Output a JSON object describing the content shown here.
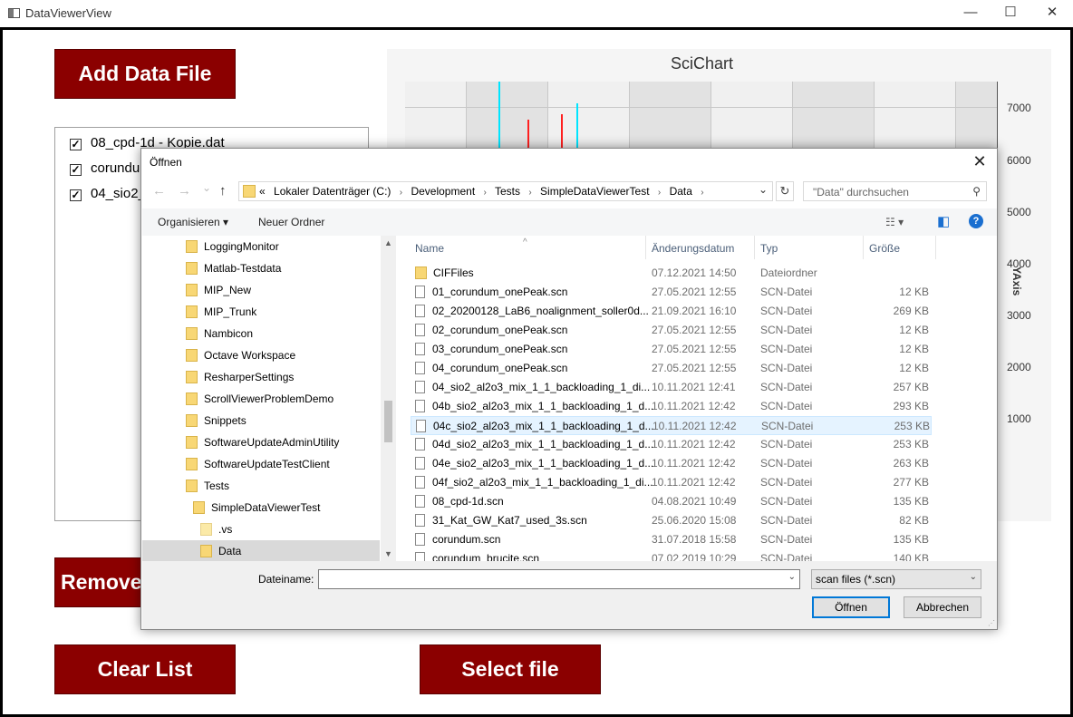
{
  "window": {
    "title": "DataViewerView",
    "minimize_glyph": "—",
    "maximize_glyph": "☐",
    "close_glyph": "✕"
  },
  "buttons": {
    "add": "Add Data File",
    "remove": "Remove",
    "clear": "Clear List",
    "select": "Select file"
  },
  "file_list": [
    {
      "label": "08_cpd-1d - Kopie.dat",
      "checked": true
    },
    {
      "label": "corundu",
      "checked": true
    },
    {
      "label": "04_sio2_",
      "checked": true
    }
  ],
  "chart": {
    "title": "SciChart",
    "y_axis_title": "YAxis",
    "y_ticks": [
      "7000",
      "6000",
      "5000",
      "4000",
      "3000",
      "2000",
      "1000"
    ]
  },
  "chart_data": {
    "type": "line",
    "title": "SciChart",
    "ylabel": "YAxis",
    "y_ticks": [
      7000,
      6000,
      5000,
      4000,
      3000,
      2000,
      1000
    ],
    "ylim": [
      0,
      7500
    ],
    "grid": true,
    "series": [
      {
        "color": "#00e5ff"
      },
      {
        "color": "#ff2020"
      }
    ]
  },
  "dialog": {
    "title": "Öffnen",
    "close_glyph": "✕",
    "nav_back": "←",
    "nav_forward": "→",
    "nav_recent": "⌄",
    "nav_up": "↑",
    "breadcrumb": [
      "«",
      "Lokaler Datenträger (C:)",
      "Development",
      "Tests",
      "SimpleDataViewerTest",
      "Data"
    ],
    "breadcrumb_sep": "›",
    "address_dropdown": "⌄",
    "refresh_glyph": "↻",
    "search_placeholder": "\"Data\" durchsuchen",
    "search_glyph": "⚲",
    "toolbar": {
      "organize": "Organisieren ▾",
      "new_folder": "Neuer Ordner",
      "view_glyph": "☷ ▾",
      "pane_glyph": "◧",
      "help_glyph": "?"
    },
    "tree": [
      {
        "label": "LoggingMonitor"
      },
      {
        "label": "Matlab-Testdata"
      },
      {
        "label": "MIP_New"
      },
      {
        "label": "MIP_Trunk"
      },
      {
        "label": "Nambicon"
      },
      {
        "label": "Octave Workspace"
      },
      {
        "label": "ResharperSettings"
      },
      {
        "label": "ScrollViewerProblemDemo"
      },
      {
        "label": "Snippets"
      },
      {
        "label": "SoftwareUpdateAdminUtility"
      },
      {
        "label": "SoftwareUpdateTestClient"
      },
      {
        "label": "Tests"
      },
      {
        "label": "SimpleDataViewerTest"
      },
      {
        "label": ".vs"
      },
      {
        "label": "Data"
      }
    ],
    "columns": {
      "name": "Name",
      "date": "Änderungsdatum",
      "type": "Typ",
      "size": "Größe",
      "sort_glyph": "^"
    },
    "files": [
      {
        "name": "CIFFiles",
        "date": "07.12.2021 14:50",
        "type": "Dateiordner",
        "size": ""
      },
      {
        "name": "01_corundum_onePeak.scn",
        "date": "27.05.2021 12:55",
        "type": "SCN-Datei",
        "size": "12 KB"
      },
      {
        "name": "02_20200128_LaB6_noalignment_soller0d...",
        "date": "21.09.2021 16:10",
        "type": "SCN-Datei",
        "size": "269 KB"
      },
      {
        "name": "02_corundum_onePeak.scn",
        "date": "27.05.2021 12:55",
        "type": "SCN-Datei",
        "size": "12 KB"
      },
      {
        "name": "03_corundum_onePeak.scn",
        "date": "27.05.2021 12:55",
        "type": "SCN-Datei",
        "size": "12 KB"
      },
      {
        "name": "04_corundum_onePeak.scn",
        "date": "27.05.2021 12:55",
        "type": "SCN-Datei",
        "size": "12 KB"
      },
      {
        "name": "04_sio2_al2o3_mix_1_1_backloading_1_di...",
        "date": "10.11.2021 12:41",
        "type": "SCN-Datei",
        "size": "257 KB"
      },
      {
        "name": "04b_sio2_al2o3_mix_1_1_backloading_1_d...",
        "date": "10.11.2021 12:42",
        "type": "SCN-Datei",
        "size": "293 KB"
      },
      {
        "name": "04c_sio2_al2o3_mix_1_1_backloading_1_d...",
        "date": "10.11.2021 12:42",
        "type": "SCN-Datei",
        "size": "253 KB"
      },
      {
        "name": "04d_sio2_al2o3_mix_1_1_backloading_1_d...",
        "date": "10.11.2021 12:42",
        "type": "SCN-Datei",
        "size": "253 KB"
      },
      {
        "name": "04e_sio2_al2o3_mix_1_1_backloading_1_d...",
        "date": "10.11.2021 12:42",
        "type": "SCN-Datei",
        "size": "263 KB"
      },
      {
        "name": "04f_sio2_al2o3_mix_1_1_backloading_1_di...",
        "date": "10.11.2021 12:42",
        "type": "SCN-Datei",
        "size": "277 KB"
      },
      {
        "name": "08_cpd-1d.scn",
        "date": "04.08.2021 10:49",
        "type": "SCN-Datei",
        "size": "135 KB"
      },
      {
        "name": "31_Kat_GW_Kat7_used_3s.scn",
        "date": "25.06.2020 15:08",
        "type": "SCN-Datei",
        "size": "82 KB"
      },
      {
        "name": "corundum.scn",
        "date": "31.07.2018 15:58",
        "type": "SCN-Datei",
        "size": "135 KB"
      },
      {
        "name": "corundum_brucite.scn",
        "date": "07.02.2019 10:29",
        "type": "SCN-Datei",
        "size": "140 KB"
      }
    ],
    "filename_label": "Dateiname:",
    "filename_value": "",
    "filter_value": "scan files (*.scn)",
    "open_button": "Öffnen",
    "cancel_button": "Abbrechen",
    "check_glyph": "✓",
    "dropdown_glyph": "⌄",
    "scroll_up": "▲",
    "scroll_down": "▼",
    "grip_glyph": "⋰"
  }
}
